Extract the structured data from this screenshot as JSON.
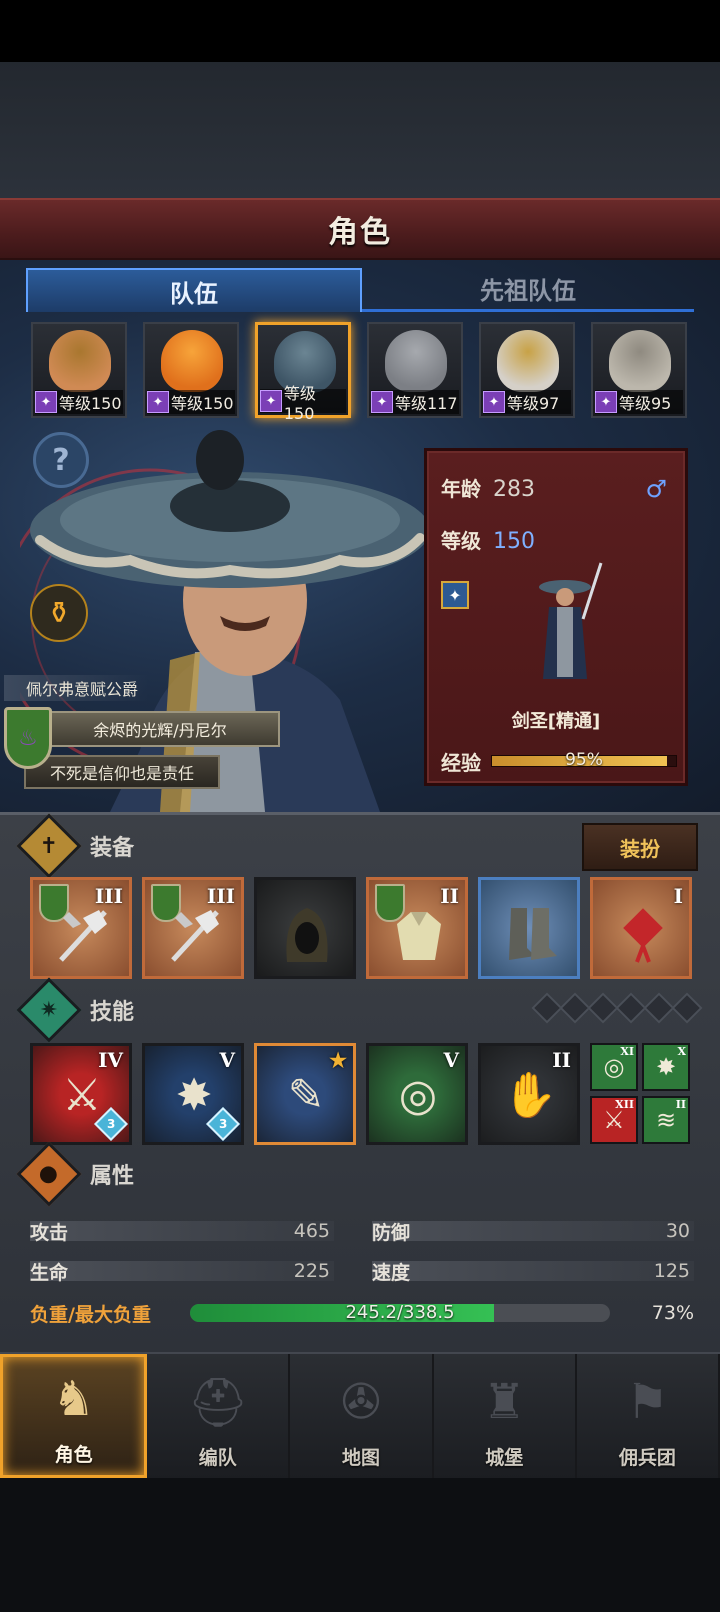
{
  "header": {
    "title": "角色"
  },
  "tabs": [
    {
      "label": "队伍",
      "active": true
    },
    {
      "label": "先祖队伍",
      "active": false
    }
  ],
  "roster": [
    {
      "level": "等级150",
      "face_color": "#d08a54",
      "accent": "#a9772f",
      "selected": false
    },
    {
      "level": "等级150",
      "face_color": "#e0701c",
      "accent": "#f7a43a",
      "selected": false
    },
    {
      "level": "等级150",
      "face_color": "#3e5566",
      "accent": "#6b8593",
      "selected": true
    },
    {
      "level": "等级117",
      "face_color": "#7c7f85",
      "accent": "#a6a9ae",
      "selected": false
    },
    {
      "level": "等级97",
      "face_color": "#d5d0c8",
      "accent": "#c8a246",
      "selected": false
    },
    {
      "level": "等级95",
      "face_color": "#bcb7ac",
      "accent": "#8f8a80",
      "selected": false
    }
  ],
  "hero": {
    "noble_title": "佩尔弗意赋公爵",
    "main_title": "余烬的光辉/丹尼尔",
    "sub_title": "不死是信仰也是责任"
  },
  "info": {
    "age_label": "年龄",
    "age": "283",
    "gender_icon": "♂",
    "level_label": "等级",
    "level": "150",
    "class_name": "剑圣[精通]",
    "exp_label": "经验",
    "exp_text": "95%",
    "exp_value": 0.95
  },
  "equipment": {
    "title": "装备",
    "dress_button": "装扮",
    "slots": [
      {
        "tier": "III",
        "style": "orange",
        "shield": true,
        "item": "halberd"
      },
      {
        "tier": "III",
        "style": "orange",
        "shield": true,
        "item": "halberd"
      },
      {
        "tier": "",
        "style": "plain",
        "shield": false,
        "item": "hood"
      },
      {
        "tier": "II",
        "style": "orange",
        "shield": true,
        "item": "armor"
      },
      {
        "tier": "",
        "style": "blue",
        "shield": false,
        "item": "boots"
      },
      {
        "tier": "I",
        "style": "orange",
        "shield": false,
        "item": "knot-charm"
      }
    ]
  },
  "skills": {
    "title": "技能",
    "gem_slots": 6,
    "list": [
      {
        "tier": "IV",
        "bg": "#b82424",
        "glyph": "⚔",
        "badge": "3"
      },
      {
        "tier": "V",
        "bg": "#23406b",
        "glyph": "✸",
        "badge": "3"
      },
      {
        "tier": "",
        "bg": "#2d4a7a",
        "glyph": "✎",
        "badge": "",
        "star": "★"
      },
      {
        "tier": "V",
        "bg": "#2e6b3a",
        "glyph": "◎",
        "badge": ""
      },
      {
        "tier": "II",
        "bg": "#2f3236",
        "glyph": "✋",
        "badge": ""
      }
    ],
    "mini": [
      {
        "tier": "XI",
        "bg": "#2e7a3a",
        "glyph": "◎"
      },
      {
        "tier": "X",
        "bg": "#2e7a3a",
        "glyph": "✸"
      },
      {
        "tier": "XII",
        "bg": "#b82424",
        "glyph": "⚔"
      },
      {
        "tier": "II",
        "bg": "#2e7a3a",
        "glyph": "≋"
      }
    ]
  },
  "attributes": {
    "title": "属性",
    "attack_label": "攻击",
    "attack": "465",
    "defense_label": "防御",
    "defense": "30",
    "hp_label": "生命",
    "hp": "225",
    "speed_label": "速度",
    "speed": "125",
    "load_label": "负重/最大负重",
    "load_text": "245.2/338.5",
    "load_pct": "73%",
    "load_value": 0.724
  },
  "nav": [
    {
      "label": "角色",
      "icon": "knight-icon",
      "glyph": "♞",
      "active": true
    },
    {
      "label": "编队",
      "icon": "helmet-icon",
      "glyph": "⛑",
      "active": false
    },
    {
      "label": "地图",
      "icon": "compass-icon",
      "glyph": "✇",
      "active": false
    },
    {
      "label": "城堡",
      "icon": "castle-icon",
      "glyph": "♜",
      "active": false
    },
    {
      "label": "佣兵团",
      "icon": "banner-icon",
      "glyph": "⚑",
      "active": false
    }
  ]
}
